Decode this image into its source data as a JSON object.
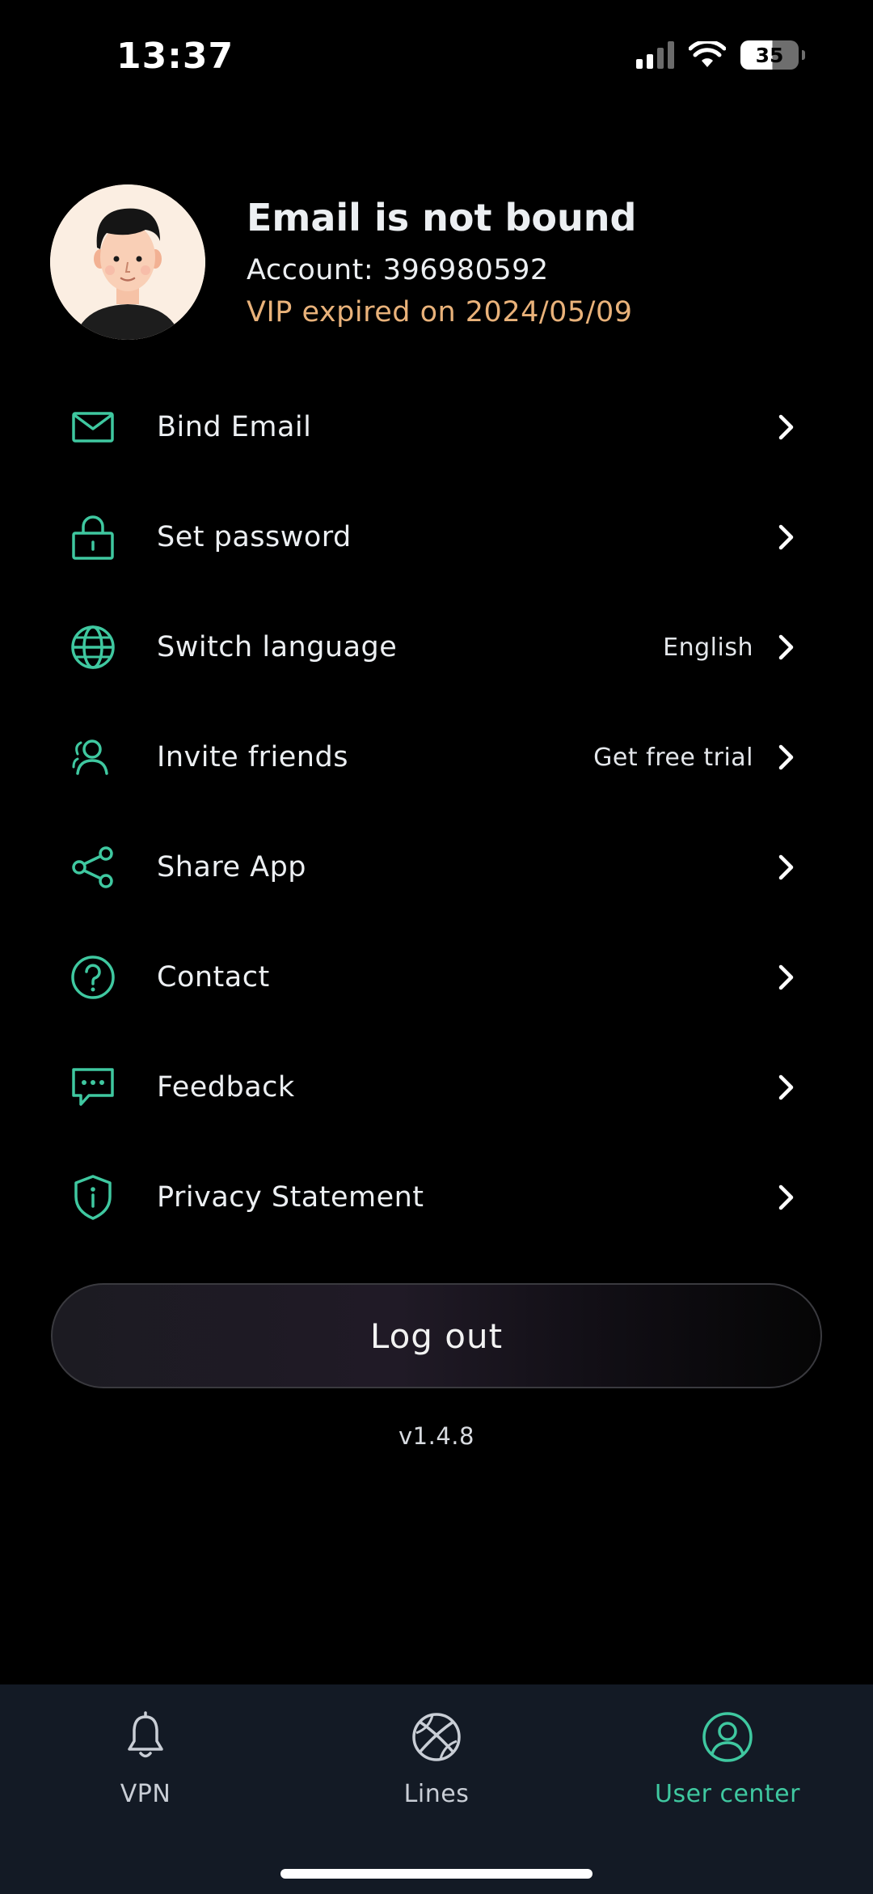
{
  "status_bar": {
    "time": "13:37",
    "battery": "35"
  },
  "profile": {
    "title": "Email is not bound",
    "account": "Account: 396980592",
    "vip": "VIP expired on 2024/05/09"
  },
  "menu": {
    "items": [
      {
        "label": "Bind Email",
        "value": "",
        "icon": "mail-icon"
      },
      {
        "label": "Set password",
        "value": "",
        "icon": "lock-icon"
      },
      {
        "label": "Switch language",
        "value": "English",
        "icon": "globe-icon"
      },
      {
        "label": "Invite friends",
        "value": "Get free trial",
        "icon": "users-icon"
      },
      {
        "label": "Share App",
        "value": "",
        "icon": "share-icon"
      },
      {
        "label": "Contact",
        "value": "",
        "icon": "question-icon"
      },
      {
        "label": "Feedback",
        "value": "",
        "icon": "chat-icon"
      },
      {
        "label": "Privacy Statement",
        "value": "",
        "icon": "shield-icon"
      }
    ]
  },
  "logout_label": "Log out",
  "version": "v1.4.8",
  "tabs": [
    {
      "label": "VPN",
      "icon": "bell-icon",
      "active": false
    },
    {
      "label": "Lines",
      "icon": "basketball-globe-icon",
      "active": false
    },
    {
      "label": "User center",
      "icon": "user-circle-icon",
      "active": true
    }
  ],
  "colors": {
    "accent": "#3fc8a0",
    "vip_text": "#e9b27a",
    "background": "#000000",
    "tabbar": "#131a25"
  }
}
